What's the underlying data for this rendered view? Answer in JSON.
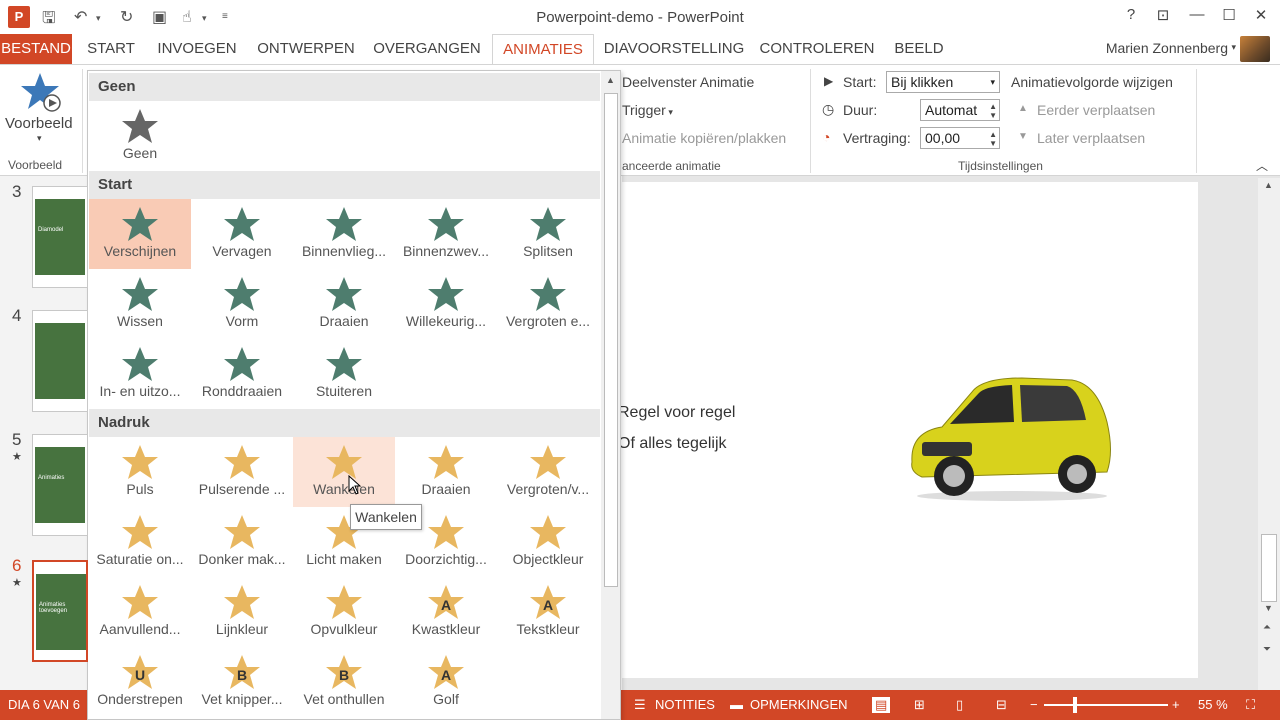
{
  "window": {
    "title": "Powerpoint-demo - PowerPoint",
    "help": "?",
    "restore_ribbon": "⊡",
    "minimize": "—",
    "maximize": "☐",
    "close": "✕"
  },
  "tabs": [
    "BESTAND",
    "START",
    "INVOEGEN",
    "ONTWERPEN",
    "OVERGANGEN",
    "ANIMATIES",
    "DIAVOORSTELLING",
    "CONTROLEREN",
    "BEELD"
  ],
  "user": {
    "name": "Marien Zonnenberg"
  },
  "ribbon": {
    "preview_label": "Voorbeeld",
    "preview_group": "Voorbeeld",
    "animation_pane": "Deelvenster Animatie",
    "trigger": "Trigger",
    "copy_animation": "Animatie kopiëren/plakken",
    "advanced_group": "anceerde animatie",
    "start_label": "Start:",
    "start_value": "Bij klikken",
    "duration_label": "Duur:",
    "duration_value": "Automat",
    "delay_label": "Vertraging:",
    "delay_value": "00,00",
    "reorder_title": "Animatievolgorde wijzigen",
    "move_earlier": "Eerder verplaatsen",
    "move_later": "Later verplaatsen",
    "timing_group": "Tijdsinstellingen"
  },
  "gallery": {
    "sections": [
      {
        "title": "Geen",
        "items": [
          {
            "label": "Geen",
            "kind": "none"
          }
        ]
      },
      {
        "title": "Start",
        "items": [
          {
            "label": "Verschijnen",
            "kind": "entry",
            "selected": true
          },
          {
            "label": "Vervagen",
            "kind": "entry"
          },
          {
            "label": "Binnenvlieg...",
            "kind": "entry"
          },
          {
            "label": "Binnenzwev...",
            "kind": "entry"
          },
          {
            "label": "Splitsen",
            "kind": "entry"
          },
          {
            "label": "Wissen",
            "kind": "entry"
          },
          {
            "label": "Vorm",
            "kind": "entry"
          },
          {
            "label": "Draaien",
            "kind": "entry"
          },
          {
            "label": "Willekeurig...",
            "kind": "entry"
          },
          {
            "label": "Vergroten e...",
            "kind": "entry"
          },
          {
            "label": "In- en uitzo...",
            "kind": "entry"
          },
          {
            "label": "Ronddraaien",
            "kind": "entry"
          },
          {
            "label": "Stuiteren",
            "kind": "entry"
          }
        ]
      },
      {
        "title": "Nadruk",
        "items": [
          {
            "label": "Puls",
            "kind": "emph"
          },
          {
            "label": "Pulserende ...",
            "kind": "emph"
          },
          {
            "label": "Wankelen",
            "kind": "emph",
            "hover": true
          },
          {
            "label": "Draaien",
            "kind": "emph"
          },
          {
            "label": "Vergroten/v...",
            "kind": "emph"
          },
          {
            "label": "Saturatie on...",
            "kind": "emph"
          },
          {
            "label": "Donker mak...",
            "kind": "emph"
          },
          {
            "label": "Licht maken",
            "kind": "emph"
          },
          {
            "label": "Doorzichtig...",
            "kind": "emph"
          },
          {
            "label": "Objectkleur",
            "kind": "emph"
          },
          {
            "label": "Aanvullend...",
            "kind": "emph"
          },
          {
            "label": "Lijnkleur",
            "kind": "emph"
          },
          {
            "label": "Opvulkleur",
            "kind": "emph"
          },
          {
            "label": "Kwastkleur",
            "kind": "emph",
            "letter": "A"
          },
          {
            "label": "Tekstkleur",
            "kind": "emph",
            "letter": "A"
          },
          {
            "label": "Onderstrepen",
            "kind": "emph",
            "letter": "U"
          },
          {
            "label": "Vet knipper...",
            "kind": "emph",
            "letter": "B"
          },
          {
            "label": "Vet onthullen",
            "kind": "emph",
            "letter": "B"
          },
          {
            "label": "Golf",
            "kind": "emph",
            "letter": "A"
          }
        ]
      }
    ],
    "tooltip": "Wankelen"
  },
  "thumbs": [
    {
      "num": "3",
      "text": "Diamodel",
      "star": ""
    },
    {
      "num": "4",
      "text": "",
      "star": ""
    },
    {
      "num": "5",
      "text": "Animaties",
      "star": "★"
    },
    {
      "num": "6",
      "text": "Animaties toevoegen",
      "star": "★"
    }
  ],
  "slide": {
    "line1": "Regel voor regel",
    "line2": "Of alles tegelijk"
  },
  "status": {
    "slide": "DIA 6 VAN 6",
    "notes": "NOTITIES",
    "comments": "OPMERKINGEN",
    "zoom": "55 %"
  },
  "colors": {
    "accent": "#d24726",
    "entry_star": "#4e7d6e",
    "emph_star": "#e8b760"
  }
}
